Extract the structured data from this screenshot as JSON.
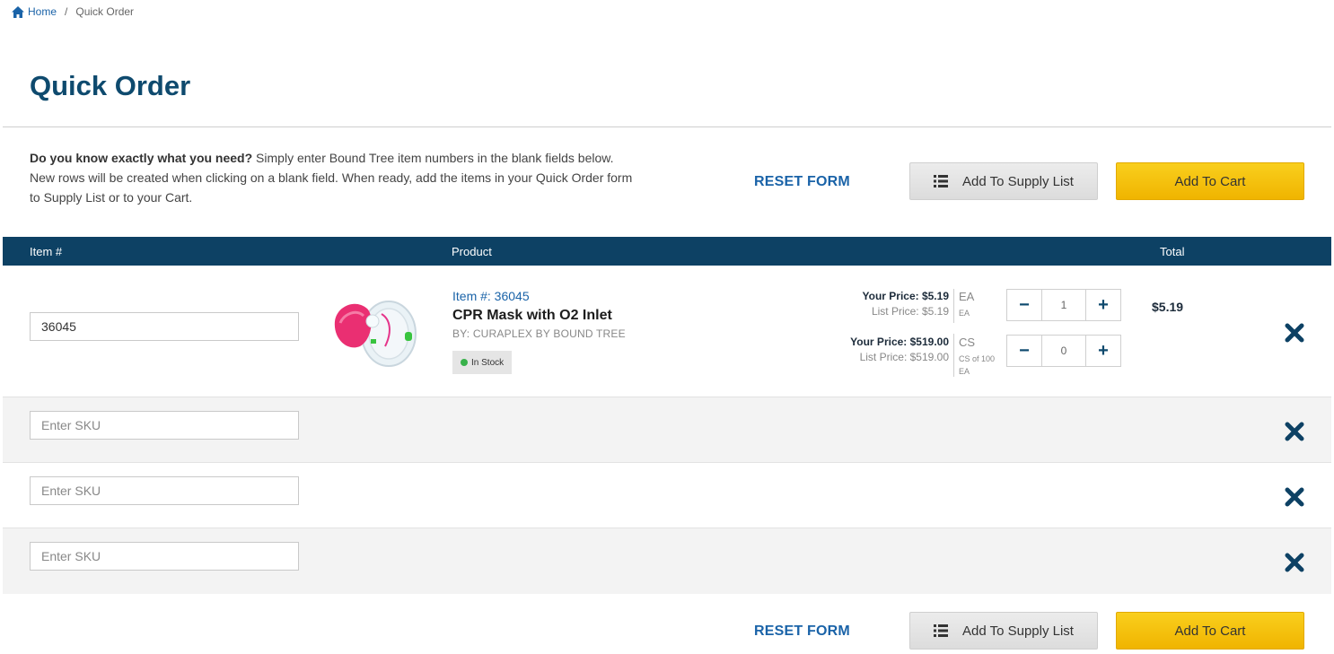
{
  "breadcrumb": {
    "home": "Home",
    "separator": "/",
    "current": "Quick Order"
  },
  "page": {
    "title": "Quick Order"
  },
  "intro": {
    "bold": "Do you know exactly what you need?",
    "text": " Simply enter Bound Tree item numbers in the blank fields below. New rows will be created when clicking on a blank field. When ready, add the items in your Quick Order form to Supply List or to your Cart."
  },
  "actions": {
    "reset": "RESET FORM",
    "supply_list": "Add To Supply List",
    "cart": "Add To Cart"
  },
  "table": {
    "headers": {
      "item": "Item #",
      "product": "Product",
      "total": "Total"
    }
  },
  "rows": [
    {
      "sku": "36045",
      "item_label": "Item #: 36045",
      "name": "CPR Mask with O2 Inlet",
      "brand": "BY: CURAPLEX BY BOUND TREE",
      "stock": "In Stock",
      "prices": [
        {
          "your": "Your Price: $5.19",
          "list": "List Price: $5.19",
          "uom": "EA",
          "uom_detail": "EA",
          "qty": "1"
        },
        {
          "your": "Your Price: $519.00",
          "list": "List Price: $519.00",
          "uom": "CS",
          "uom_detail": "CS of 100 EA",
          "qty": "0"
        }
      ],
      "total": "$5.19"
    },
    {
      "placeholder": "Enter SKU"
    },
    {
      "placeholder": "Enter SKU"
    },
    {
      "placeholder": "Enter SKU"
    }
  ],
  "colors": {
    "primary": "#0d4164",
    "link": "#1a63a8",
    "cart": "#f5c20f",
    "in_stock": "#38b14a"
  }
}
